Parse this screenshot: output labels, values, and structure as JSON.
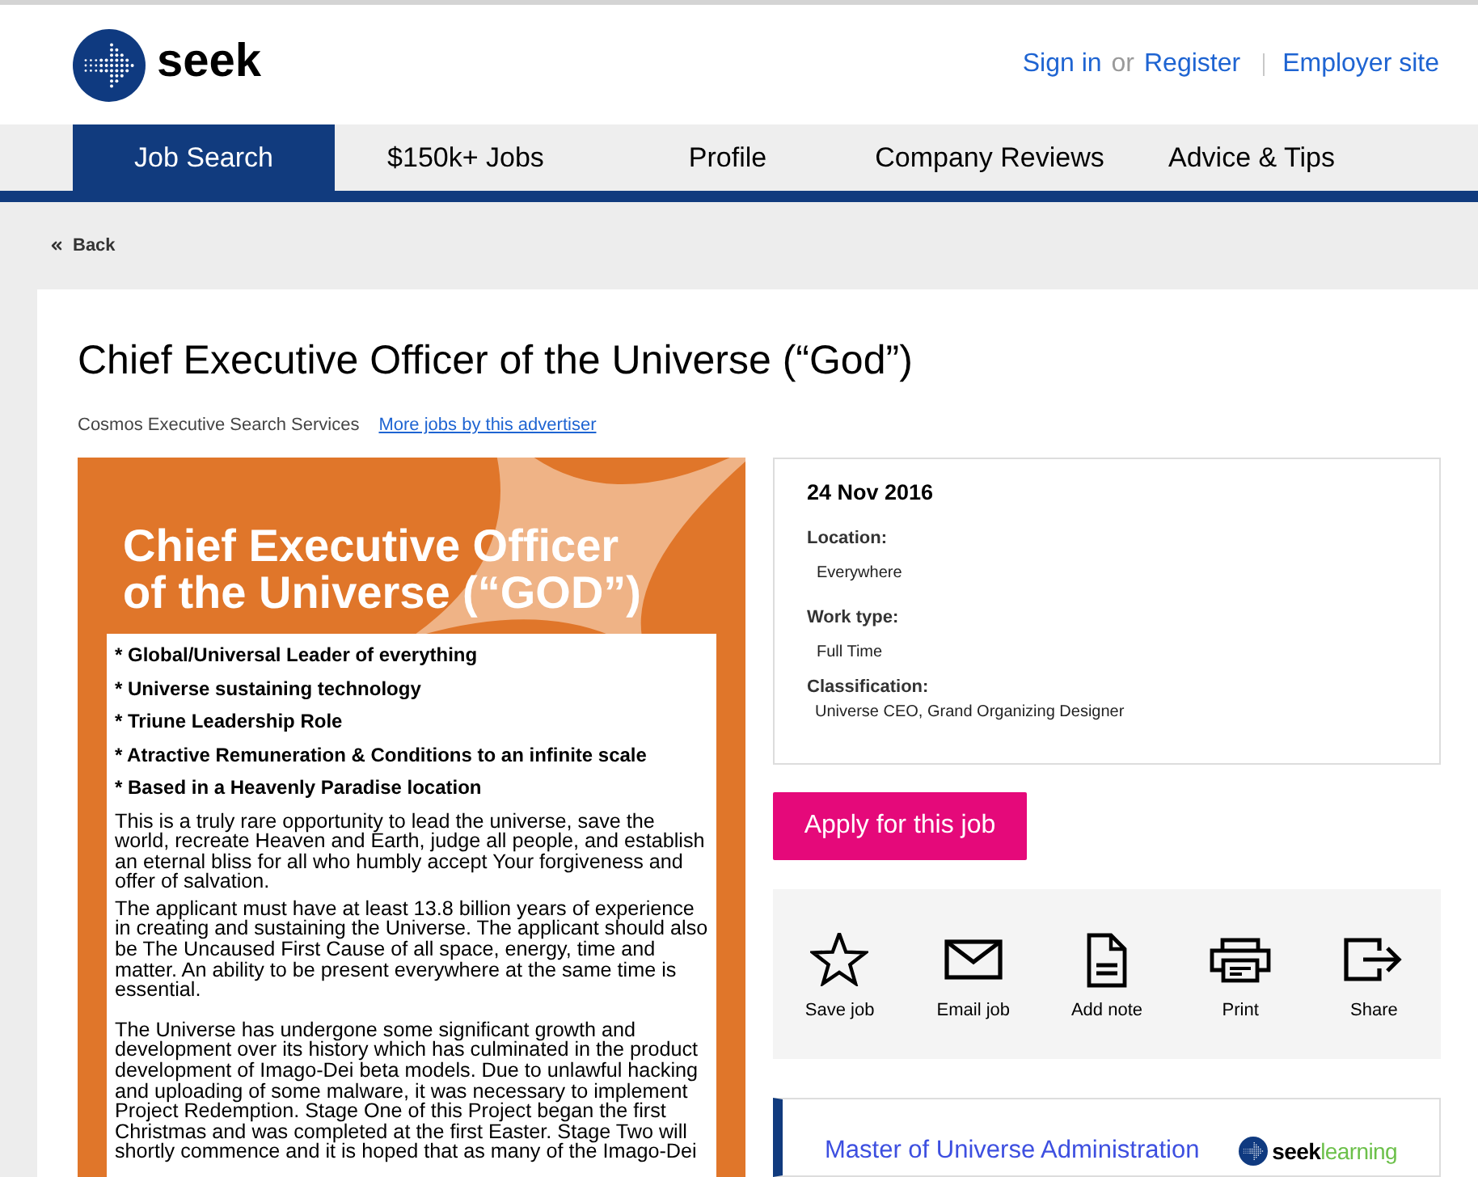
{
  "header": {
    "logo_text": "seek",
    "account_links": [
      {
        "label": "Sign in",
        "kind": "link"
      },
      {
        "label": "or",
        "kind": "text"
      },
      {
        "label": "Register",
        "kind": "link"
      }
    ],
    "employer_link": "Employer site"
  },
  "nav": {
    "tabs": [
      {
        "label": "Job Search",
        "selected": true
      },
      {
        "label": "$150k+ Jobs",
        "selected": false
      },
      {
        "label": "Profile",
        "selected": false
      },
      {
        "label": "Company Reviews",
        "selected": false
      },
      {
        "label": "Advice & Tips",
        "selected": false
      }
    ]
  },
  "back_link": "Back",
  "job": {
    "title": "Chief Executive Officer of the Universe (“God”)",
    "advertiser": "Cosmos Executive Search Services",
    "more_jobs_link": "More jobs by this advertiser"
  },
  "ad": {
    "title_lines": [
      "Chief Executive Officer",
      "of the Universe (“GOD”)"
    ],
    "bullets": [
      "* Global/Universal Leader of everything",
      "* Universe sustaining technology",
      "* Triune Leadership Role",
      "* Atractive Remuneration & Conditions to an infinite scale",
      "* Based in a Heavenly Paradise location"
    ],
    "paragraphs": [
      "This is a truly rare opportunity to lead the universe, save the world, recreate Heaven and Earth, judge all people, and establish an eternal bliss for all who humbly accept Your forgiveness and offer of salvation.",
      "The applicant must have at least 13.8 billion years of experience in creating and sustaining the Universe. The applicant should also be The Uncaused First Cause of all space, energy, time and matter. An ability to be present everywhere at the same time is essential.",
      "The Universe has undergone some significant growth and development over its history which has culminated in the product development of Imago-Dei beta models. Due to unlawful hacking and uploading of some malware, it was necessary to implement Project Redemption. Stage One of this Project began the first Christmas and was completed at the first Easter. Stage Two will shortly commence and it is hoped that as many of the Imago-Dei"
    ]
  },
  "details": {
    "date": "24 Nov 2016",
    "fields": [
      {
        "label": "Location:",
        "value": "Everywhere"
      },
      {
        "label": "Work type:",
        "value": "Full Time"
      },
      {
        "label": "Classification:",
        "value": "Universe CEO, Grand Organizing Designer"
      }
    ]
  },
  "apply_button": "Apply for this job",
  "actions": [
    {
      "label": "Save job",
      "kind": "save"
    },
    {
      "label": "Email job",
      "kind": "email"
    },
    {
      "label": "Add note",
      "kind": "note"
    },
    {
      "label": "Print",
      "kind": "print"
    },
    {
      "label": "Share",
      "kind": "share"
    }
  ],
  "promo": {
    "title": "Master of Universe Administration",
    "logo_bold": "seek",
    "logo_light": "learning"
  }
}
